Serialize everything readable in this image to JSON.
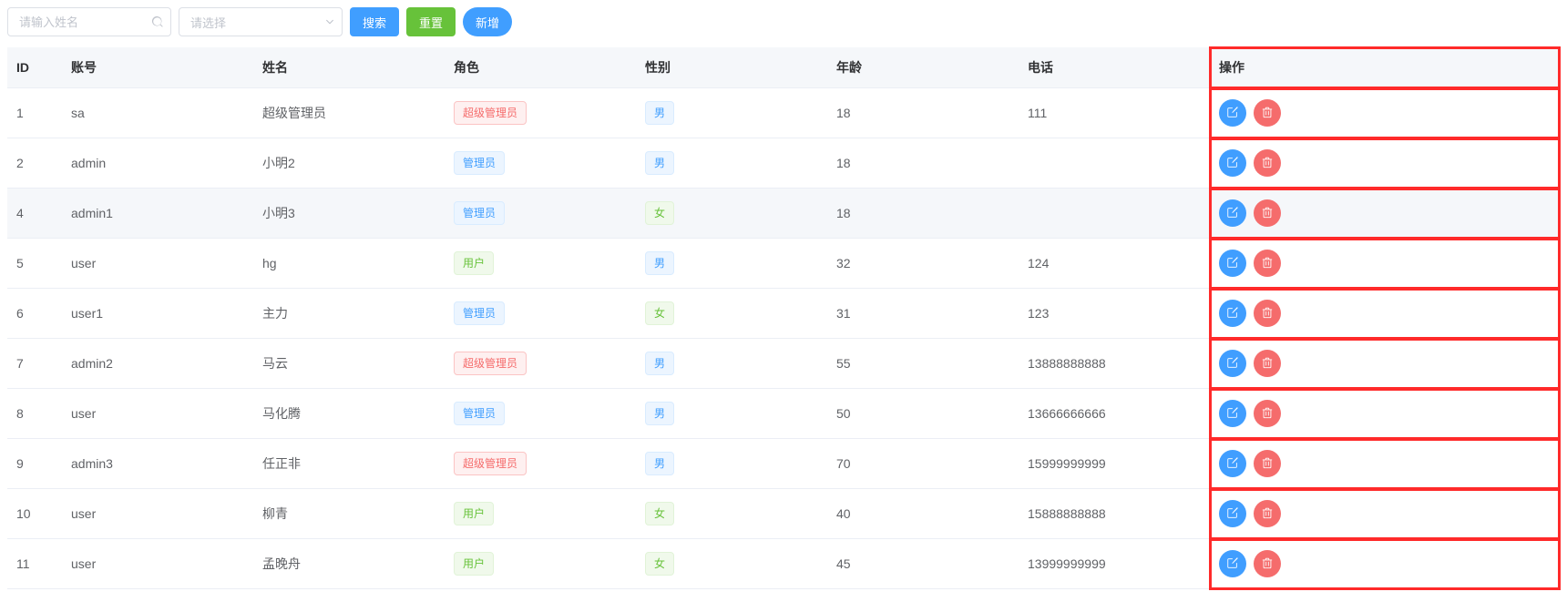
{
  "search": {
    "name_placeholder": "请输入姓名",
    "select_placeholder": "请选择",
    "btn_search": "搜索",
    "btn_reset": "重置",
    "btn_add": "新增"
  },
  "columns": {
    "id": "ID",
    "account": "账号",
    "name": "姓名",
    "role": "角色",
    "sex": "性别",
    "age": "年龄",
    "phone": "电话",
    "op": "操作"
  },
  "role_styles": {
    "超级管理员": "danger",
    "管理员": "primary",
    "用户": "success"
  },
  "sex_styles": {
    "男": "primary",
    "女": "success"
  },
  "rows": [
    {
      "id": "1",
      "account": "sa",
      "name": "超级管理员",
      "role": "超级管理员",
      "sex": "男",
      "age": "18",
      "phone": "111"
    },
    {
      "id": "2",
      "account": "admin",
      "name": "小明2",
      "role": "管理员",
      "sex": "男",
      "age": "18",
      "phone": ""
    },
    {
      "id": "4",
      "account": "admin1",
      "name": "小明3",
      "role": "管理员",
      "sex": "女",
      "age": "18",
      "phone": "",
      "hovered": true
    },
    {
      "id": "5",
      "account": "user",
      "name": "hg",
      "role": "用户",
      "sex": "男",
      "age": "32",
      "phone": "124"
    },
    {
      "id": "6",
      "account": "user1",
      "name": "主力",
      "role": "管理员",
      "sex": "女",
      "age": "31",
      "phone": "123"
    },
    {
      "id": "7",
      "account": "admin2",
      "name": "马云",
      "role": "超级管理员",
      "sex": "男",
      "age": "55",
      "phone": "13888888888"
    },
    {
      "id": "8",
      "account": "user",
      "name": "马化腾",
      "role": "管理员",
      "sex": "男",
      "age": "50",
      "phone": "13666666666"
    },
    {
      "id": "9",
      "account": "admin3",
      "name": "任正非",
      "role": "超级管理员",
      "sex": "男",
      "age": "70",
      "phone": "15999999999"
    },
    {
      "id": "10",
      "account": "user",
      "name": "柳青",
      "role": "用户",
      "sex": "女",
      "age": "40",
      "phone": "15888888888"
    },
    {
      "id": "11",
      "account": "user",
      "name": "孟晚舟",
      "role": "用户",
      "sex": "女",
      "age": "45",
      "phone": "13999999999"
    }
  ],
  "icons": {
    "edit": "edit-icon",
    "delete": "trash-icon",
    "search": "search-icon",
    "chevron": "chevron-down-icon"
  }
}
